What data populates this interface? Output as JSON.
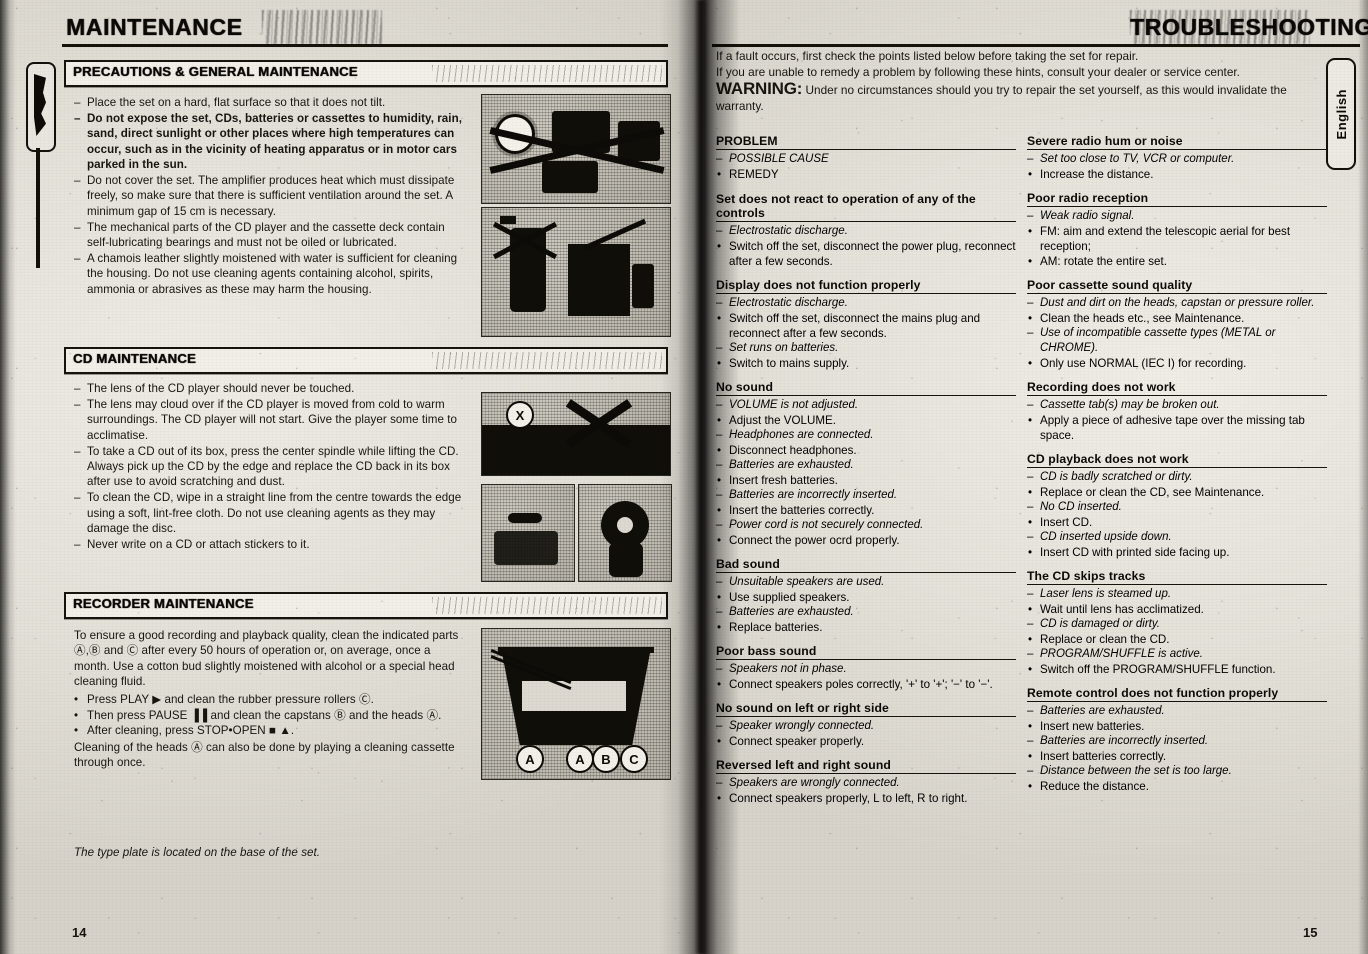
{
  "document": {
    "left_page_number": "14",
    "right_page_number": "15",
    "language_tab": "English"
  },
  "left_page": {
    "banner_title": "MAINTENANCE",
    "sections": [
      {
        "id": "precautions",
        "heading": "PRECAUTIONS & GENERAL MAINTENANCE",
        "items": [
          {
            "bold": false,
            "text": "Place the set on a hard, flat surface so that it does not tilt."
          },
          {
            "bold": true,
            "text": "Do not expose the set, CDs, batteries or cassettes to humidity, rain, sand, direct sunlight or other places where high temperatures can occur, such as in the vicinity of heating apparatus or in motor cars parked in the sun."
          },
          {
            "bold": false,
            "text": "Do not cover the set. The amplifier produces heat which must dissipate freely, so make sure that there is sufficient ventilation around the set. A minimum gap of 15 cm is necessary."
          },
          {
            "bold": false,
            "text": "The mechanical parts of the CD player and the cassette deck contain self-lubricating bearings and must not be oiled or lubricated."
          },
          {
            "bold": false,
            "text": "A chamois leather slightly moistened with water is sufficient for cleaning the housing. Do not use cleaning agents containing alcohol, spirits, ammonia or abrasives as these may harm the housing."
          }
        ]
      },
      {
        "id": "cd-maintenance",
        "heading": "CD MAINTENANCE",
        "items": [
          {
            "bold": false,
            "text": "The lens of the CD player should never be touched."
          },
          {
            "bold": false,
            "text": "The lens may cloud over if the CD player is moved from cold to warm surroundings. The CD player will not start. Give the player some time to acclimatise."
          },
          {
            "bold": false,
            "text": "To take a CD out of its box, press the center spindle while lifting the CD. Always pick up the CD by the edge and replace the CD back in its box after use to avoid scratching and dust."
          },
          {
            "bold": false,
            "text": "To clean the CD, wipe in a straight line from the centre towards the edge using a soft, lint-free cloth. Do not use cleaning agents as they may damage the disc."
          },
          {
            "bold": false,
            "text": "Never write on a CD or attach stickers to it."
          }
        ]
      },
      {
        "id": "recorder-maintenance",
        "heading": "RECORDER MAINTENANCE",
        "paragraph_1": "To ensure a good recording and playback quality, clean the indicated parts Ⓐ,Ⓑ and Ⓒ after every 50 hours of operation or, on average, once a month. Use a cotton bud slightly moistened with alcohol or a special head cleaning fluid.",
        "bullets": [
          "Press PLAY ▶ and clean the rubber pressure rollers Ⓒ.",
          "Then press PAUSE ▐▐ and clean the capstans Ⓑ and the heads Ⓐ.",
          "After cleaning, press STOP•OPEN ■ ▲."
        ],
        "paragraph_2": "Cleaning of the heads Ⓐ can also be done by playing a cleaning cassette through once."
      }
    ],
    "footnote": "The type plate is located on the base of the set.",
    "illustration_labels": [
      "A",
      "A",
      "B",
      "C"
    ],
    "illustration_x_mark": "X"
  },
  "right_page": {
    "banner_title": "TROUBLESHOOTING",
    "intro": {
      "line_1": "If a fault occurs, first check the points listed below before taking the set for repair.",
      "line_2": "If you are unable to remedy a problem by following these hints, consult your dealer or service center.",
      "warning_label": "WARNING:",
      "warning_text": "Under no circumstances should you try to repair the set yourself, as this would invalidate the warranty."
    },
    "legend": {
      "heading": "PROBLEM",
      "cause_label": "POSSIBLE CAUSE",
      "remedy_label": "REMEDY"
    },
    "column_1": [
      {
        "problem": "Set does not react to operation of any of the controls",
        "entries": [
          {
            "type": "cause",
            "text": "Electrostatic discharge."
          },
          {
            "type": "remedy",
            "text": "Switch off the set, disconnect the power plug, reconnect after a few seconds."
          }
        ]
      },
      {
        "problem": "Display does not function properly",
        "entries": [
          {
            "type": "cause",
            "text": "Electrostatic discharge."
          },
          {
            "type": "remedy",
            "text": "Switch off the set, disconnect the mains plug and reconnect after a few seconds."
          },
          {
            "type": "cause",
            "text": "Set runs on batteries."
          },
          {
            "type": "remedy",
            "text": "Switch to mains supply."
          }
        ]
      },
      {
        "problem": "No sound",
        "entries": [
          {
            "type": "cause",
            "text": "VOLUME is not adjusted."
          },
          {
            "type": "remedy",
            "text": "Adjust the VOLUME."
          },
          {
            "type": "cause",
            "text": "Headphones are connected."
          },
          {
            "type": "remedy",
            "text": "Disconnect headphones."
          },
          {
            "type": "cause",
            "text": "Batteries are exhausted."
          },
          {
            "type": "remedy",
            "text": "Insert fresh batteries."
          },
          {
            "type": "cause",
            "text": "Batteries are incorrectly inserted."
          },
          {
            "type": "remedy",
            "text": "Insert the batteries correctly."
          },
          {
            "type": "cause",
            "text": "Power cord is not securely connected."
          },
          {
            "type": "remedy",
            "text": "Connect the power ocrd properly."
          }
        ]
      },
      {
        "problem": "Bad sound",
        "entries": [
          {
            "type": "cause",
            "text": "Unsuitable speakers are used."
          },
          {
            "type": "remedy",
            "text": "Use supplied speakers."
          },
          {
            "type": "cause",
            "text": "Batteries are exhausted."
          },
          {
            "type": "remedy",
            "text": "Replace batteries."
          }
        ]
      },
      {
        "problem": "Poor bass sound",
        "entries": [
          {
            "type": "cause",
            "text": "Speakers not in phase."
          },
          {
            "type": "remedy",
            "text": "Connect speakers poles correctly, '+' to '+'; '−' to '−'."
          }
        ]
      },
      {
        "problem": "No sound on left or right side",
        "entries": [
          {
            "type": "cause",
            "text": "Speaker wrongly connected."
          },
          {
            "type": "remedy",
            "text": "Connect speaker properly."
          }
        ]
      },
      {
        "problem": "Reversed left and right sound",
        "entries": [
          {
            "type": "cause",
            "text": "Speakers are wrongly connected."
          },
          {
            "type": "remedy",
            "text": "Connect speakers properly, L to left, R to right."
          }
        ]
      }
    ],
    "column_2": [
      {
        "problem": "Severe radio hum or noise",
        "entries": [
          {
            "type": "cause",
            "text": "Set too close to TV, VCR or computer."
          },
          {
            "type": "remedy",
            "text": "Increase the distance."
          }
        ]
      },
      {
        "problem": "Poor radio reception",
        "entries": [
          {
            "type": "cause",
            "text": "Weak radio signal."
          },
          {
            "type": "remedy",
            "text": "FM: aim and extend the telescopic aerial for best reception;"
          },
          {
            "type": "remedy",
            "text": "AM: rotate the entire set."
          }
        ]
      },
      {
        "problem": "Poor cassette sound quality",
        "entries": [
          {
            "type": "cause",
            "text": "Dust and dirt on the heads, capstan or pressure roller."
          },
          {
            "type": "remedy",
            "text": "Clean the heads etc., see Maintenance."
          },
          {
            "type": "cause",
            "text": "Use of incompatible cassette types (METAL or CHROME)."
          },
          {
            "type": "remedy",
            "text": "Only use NORMAL (IEC I) for recording."
          }
        ]
      },
      {
        "problem": "Recording does not work",
        "entries": [
          {
            "type": "cause",
            "text": "Cassette tab(s) may be broken out."
          },
          {
            "type": "remedy",
            "text": "Apply a piece of adhesive tape over the missing tab space."
          }
        ]
      },
      {
        "problem": "CD playback does not work",
        "entries": [
          {
            "type": "cause",
            "text": "CD is badly scratched or dirty."
          },
          {
            "type": "remedy",
            "text": "Replace or clean the CD, see Maintenance."
          },
          {
            "type": "cause",
            "text": "No CD inserted."
          },
          {
            "type": "remedy",
            "text": "Insert CD."
          },
          {
            "type": "cause",
            "text": "CD inserted upside down."
          },
          {
            "type": "remedy",
            "text": "Insert CD with printed side facing up."
          }
        ]
      },
      {
        "problem": "The CD skips tracks",
        "entries": [
          {
            "type": "cause",
            "text": "Laser lens is steamed up."
          },
          {
            "type": "remedy",
            "text": "Wait until lens has acclimatized."
          },
          {
            "type": "cause",
            "text": "CD is damaged or dirty."
          },
          {
            "type": "remedy",
            "text": "Replace or clean the CD."
          },
          {
            "type": "cause",
            "text": "PROGRAM/SHUFFLE is active."
          },
          {
            "type": "remedy",
            "text": "Switch off the PROGRAM/SHUFFLE function."
          }
        ]
      },
      {
        "problem": "Remote control does not function properly",
        "entries": [
          {
            "type": "cause",
            "text": "Batteries are exhausted."
          },
          {
            "type": "remedy",
            "text": "Insert new batteries."
          },
          {
            "type": "cause",
            "text": "Batteries are incorrectly inserted."
          },
          {
            "type": "remedy",
            "text": "Insert batteries correctly."
          },
          {
            "type": "cause",
            "text": "Distance between the set is too large."
          },
          {
            "type": "remedy",
            "text": "Reduce the distance."
          }
        ]
      }
    ]
  },
  "markers": {
    "dash": "–",
    "bullet": "•"
  }
}
